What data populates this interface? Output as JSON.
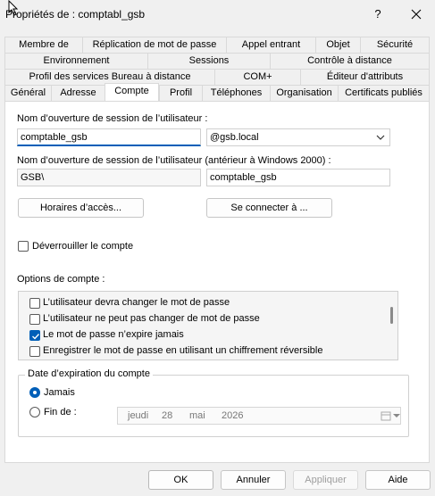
{
  "window": {
    "title": "Propriétés de : comptabl_gsb",
    "help_label": "?"
  },
  "tabs": {
    "row1": [
      "Membre de",
      "Réplication de mot de passe",
      "Appel entrant",
      "Objet",
      "Sécurité"
    ],
    "row2": [
      "Environnement",
      "Sessions",
      "Contrôle à distance"
    ],
    "row3": [
      "Profil des services Bureau à distance",
      "COM+",
      "Éditeur d'attributs"
    ],
    "row4": [
      "Général",
      "Adresse",
      "Compte",
      "Profil",
      "Téléphones",
      "Organisation",
      "Certificats publiés"
    ],
    "active": "Compte"
  },
  "account": {
    "logon_name_label": "Nom d’ouverture de session de l’utilisateur :",
    "logon_name_value": "comptable_gsb",
    "domain_value": "@gsb.local",
    "legacy_label": "Nom d’ouverture de session de l’utilisateur (antérieur à Windows 2000) :",
    "legacy_domain_value": "GSB\\",
    "legacy_name_value": "comptable_gsb",
    "logon_hours_button": "Horaires d’accès...",
    "logon_to_button": "Se connecter à ...",
    "unlock_label": "Déverrouiller le compte",
    "options_label": "Options de compte :",
    "options": [
      {
        "label": "L’utilisateur devra changer le mot de passe",
        "checked": false
      },
      {
        "label": "L’utilisateur ne peut pas changer de mot de passe",
        "checked": false
      },
      {
        "label": "Le mot de passe n’expire jamais",
        "checked": true
      },
      {
        "label": "Enregistrer le mot de passe en utilisant un chiffrement réversible",
        "checked": false
      }
    ],
    "expiration_title": "Date d’expiration du compte",
    "never_label": "Jamais",
    "end_of_label": "Fin de :",
    "date": {
      "weekday": "jeudi",
      "day": "28",
      "month": "mai",
      "year": "2026"
    }
  },
  "buttons": {
    "ok": "OK",
    "cancel": "Annuler",
    "apply": "Appliquer",
    "help": "Aide"
  }
}
